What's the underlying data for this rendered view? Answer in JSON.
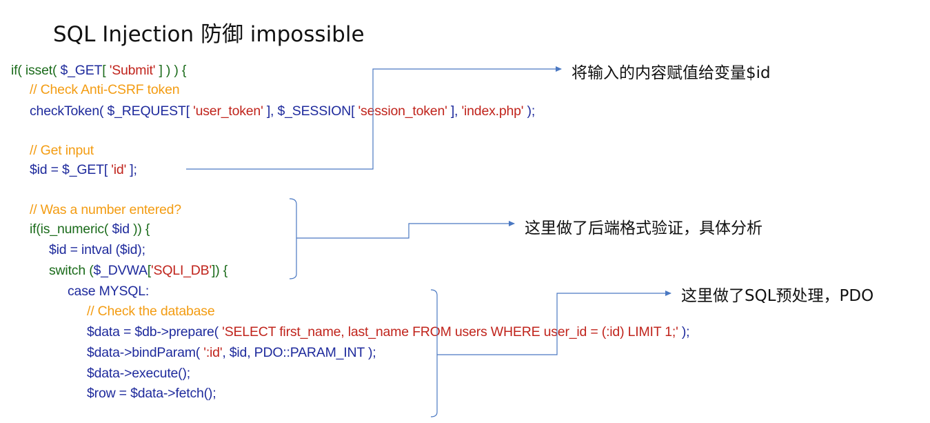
{
  "title": "SQL Injection 防御 impossible",
  "code": [
    {
      "tokens": [
        [
          "kw",
          "if( isset( "
        ],
        [
          "vr",
          "$_GET"
        ],
        [
          "kw",
          "[ "
        ],
        [
          "st",
          "'Submit'"
        ],
        [
          "kw",
          " ] ) ) {"
        ]
      ]
    },
    {
      "tokens": [
        [
          "cm",
          "// Check Anti-CSRF token"
        ]
      ]
    },
    {
      "tokens": [
        [
          "vr",
          "checkToken( $_REQUEST[ "
        ],
        [
          "st",
          "'user_token'"
        ],
        [
          "vr",
          " ], $_SESSION[ "
        ],
        [
          "st",
          "'session_token'"
        ],
        [
          "vr",
          " ], "
        ],
        [
          "st",
          "'index.php'"
        ],
        [
          "vr",
          " );"
        ]
      ]
    },
    {
      "tokens": []
    },
    {
      "tokens": [
        [
          "cm",
          "// Get input"
        ]
      ]
    },
    {
      "tokens": [
        [
          "vr",
          "$id = $_GET[ "
        ],
        [
          "st",
          "'id'"
        ],
        [
          "vr",
          " ];"
        ]
      ]
    },
    {
      "tokens": []
    },
    {
      "tokens": [
        [
          "cm",
          "// Was a number entered?"
        ]
      ]
    },
    {
      "tokens": [
        [
          "kw",
          "if(is_numeric( "
        ],
        [
          "vr",
          "$id"
        ],
        [
          "kw",
          " )) {"
        ]
      ]
    },
    {
      "tokens": [
        [
          "vr",
          "$id = intval ($id);"
        ]
      ]
    },
    {
      "tokens": [
        [
          "kw",
          "switch ("
        ],
        [
          "vr",
          "$_DVWA"
        ],
        [
          "kw",
          "["
        ],
        [
          "st",
          "'SQLI_DB'"
        ],
        [
          "kw",
          "]) {"
        ]
      ]
    },
    {
      "tokens": [
        [
          "vr",
          "case MYSQL:"
        ]
      ]
    },
    {
      "tokens": [
        [
          "cm",
          "// Check the database"
        ]
      ]
    },
    {
      "tokens": [
        [
          "vr",
          "$data = $db->prepare( "
        ],
        [
          "st",
          "'SELECT first_name, last_name FROM users WHERE user_id = (:id) LIMIT 1;'"
        ],
        [
          "vr",
          " );"
        ]
      ]
    },
    {
      "tokens": [
        [
          "vr",
          "$data->bindParam( "
        ],
        [
          "st",
          "':id'"
        ],
        [
          "vr",
          ", $id, PDO::PARAM_INT );"
        ]
      ]
    },
    {
      "tokens": [
        [
          "vr",
          "$data->execute();"
        ]
      ]
    },
    {
      "tokens": [
        [
          "vr",
          "$row = $data->fetch();"
        ]
      ]
    }
  ],
  "annotations": {
    "a1": "将输入的内容赋值给变量$id",
    "a2": "这里做了后端格式验证，具体分析",
    "a3": "这里做了SQL预处理，PDO"
  },
  "colors": {
    "keyword": "#1b6b1b",
    "comment": "#f39c12",
    "string": "#c0241c",
    "variable": "#1e2a9c",
    "connector": "#4a78c2"
  }
}
